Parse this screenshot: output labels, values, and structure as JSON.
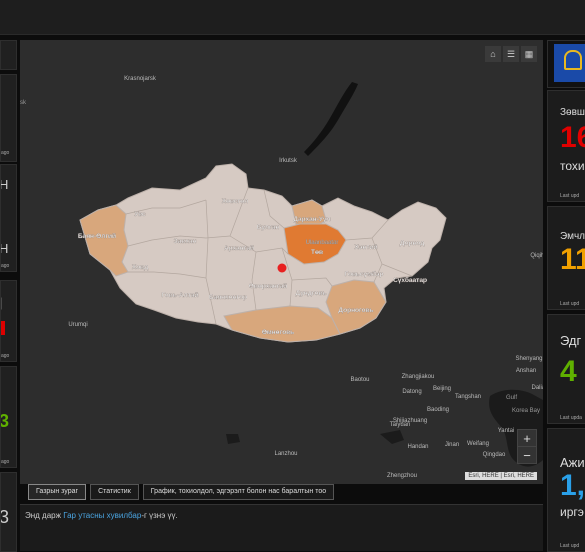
{
  "left_strip": [
    {
      "text": "",
      "updated": "ago"
    },
    {
      "text": "Н",
      "updated": ""
    },
    {
      "text": "Н",
      "updated": "ago"
    },
    {
      "text": "|",
      "updated": "ago"
    },
    {
      "text": "3",
      "updated": "ago"
    },
    {
      "text": "3",
      "updated": ""
    }
  ],
  "map": {
    "cities": [
      "Krasnojarsk",
      "Irkutsk",
      "Urumqi",
      "Baotou",
      "Zhangjiakou",
      "Datong",
      "Beijing",
      "Tangshan",
      "Baoding",
      "Shijiazhuang",
      "Taiyuan",
      "Handan",
      "Jinan",
      "Weifang",
      "Qingdao",
      "Lanzhou",
      "Zhengzhou",
      "Yantai",
      "Shenyang",
      "Anshan",
      "Dalian",
      "Qiqihar"
    ],
    "provinces": [
      "Увс",
      "Баян-Өлгий",
      "Ховд",
      "Завхан",
      "Говь-Алтай",
      "Архангай",
      "Хөвсгөл",
      "Булган",
      "Баянхонгор",
      "Өвөрхангай",
      "Өмнөговь",
      "Дундговь",
      "Дорноговь",
      "Говьсүмбэр",
      "Сүхбаатар",
      "Дорнод",
      "Хэнтий",
      "Төв",
      "Дархан-Уул",
      "Ulaanbaatar"
    ],
    "partial_labels": [
      "rsk",
      "Gulf",
      "Korea Bay"
    ],
    "attribution": "Esri, HERE | Esri, HERE",
    "zoom_in": "+",
    "zoom_out": "−",
    "tools": [
      "home-icon",
      "list-icon",
      "grid-icon"
    ]
  },
  "tabs": [
    "Газрын зураг",
    "Статистик",
    "График, тохиолдол, эдгэрэлт болон нас баралтын тоо"
  ],
  "footer": {
    "pre": "Энд дарж ",
    "link": "Гар утасны хувилбар",
    "post": "-г үзнэ үү."
  },
  "right_panels": [
    {
      "label": "Зөвш",
      "value": "16",
      "unit": "тохи",
      "updated": "Last upd",
      "color": "#e00000"
    },
    {
      "label": "Эмчлү",
      "value": "11",
      "unit": "",
      "updated": "Last upd",
      "color": "#f0a000"
    },
    {
      "label": "Эдг",
      "value": "4",
      "unit": "",
      "updated": "Last upda",
      "color": "#5fb000"
    },
    {
      "label": "Ажи",
      "value": "1,",
      "unit": "иргэ",
      "updated": "Last upd",
      "color": "#2aa0e8"
    }
  ],
  "colors": {
    "provinces": "#d6cac3",
    "affected": "#d8a77c",
    "highlight": "#e07a32",
    "case_dot": "#e82020",
    "map_bg": "#2d2d2d"
  }
}
